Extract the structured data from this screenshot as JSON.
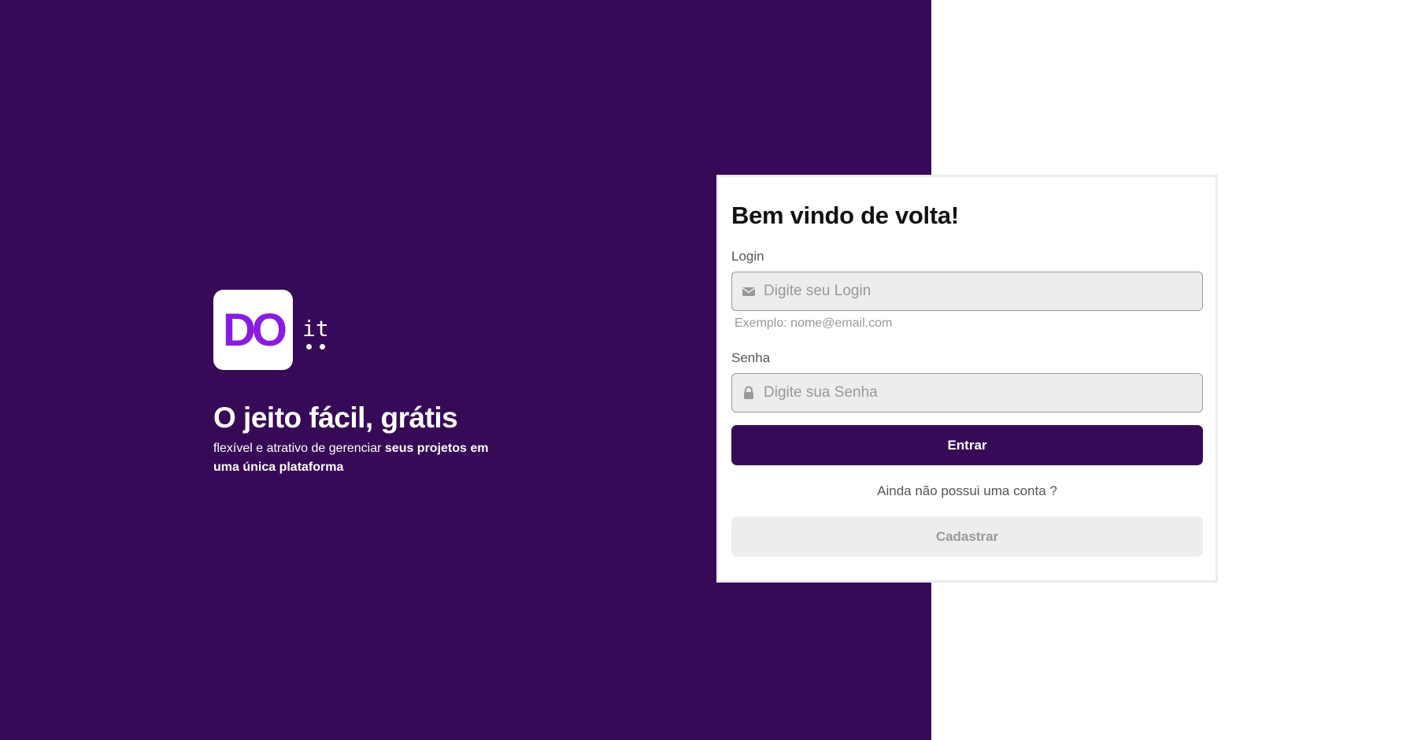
{
  "colors": {
    "brand_dark": "#370a58",
    "brand_accent": "#8a1be0",
    "input_bg": "#ededed",
    "muted_text": "#999999"
  },
  "brand": {
    "logo_main": "DO",
    "logo_suffix": "it",
    "tagline": "O jeito fácil, grátis",
    "subtitle_plain": "flexível e atrativo de gerenciar ",
    "subtitle_bold": "seus projetos em uma única plataforma"
  },
  "login_form": {
    "title": "Bem vindo de volta!",
    "login_label": "Login",
    "login_placeholder": "Digite seu Login",
    "login_icon": "envelope-icon",
    "login_hint": "Exemplo: nome@email.com",
    "password_label": "Senha",
    "password_placeholder": "Digite sua Senha",
    "password_icon": "lock-icon",
    "submit_label": "Entrar",
    "signup_prompt": "Ainda não possui uma conta ?",
    "signup_label": "Cadastrar"
  }
}
